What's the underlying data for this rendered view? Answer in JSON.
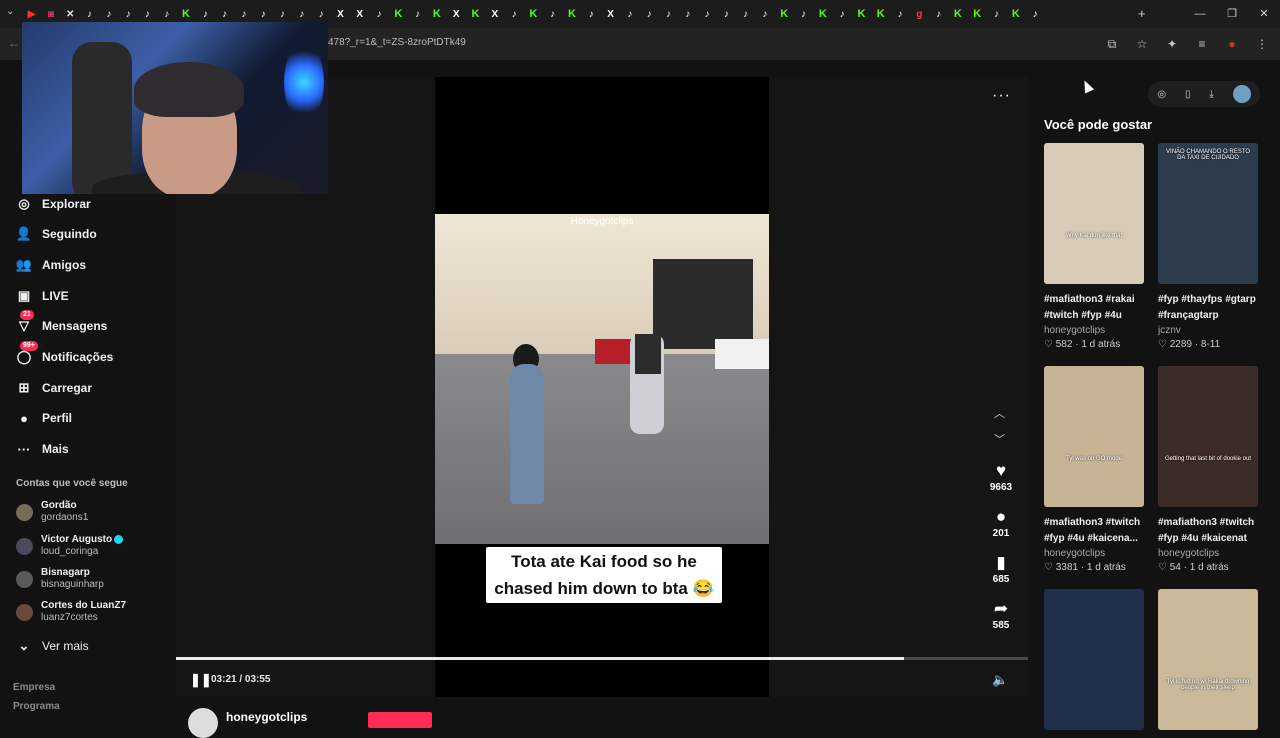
{
  "browser": {
    "url": "478?_r=1&_t=ZS-8zroPtDTk49",
    "tab_icons": [
      "yt",
      "ig",
      "close",
      "tk",
      "tk",
      "tk",
      "tk",
      "tk",
      "kk",
      "tk",
      "tk",
      "tk",
      "tk",
      "tk",
      "tk",
      "tk",
      "xx",
      "xx",
      "tk",
      "kk",
      "tk",
      "kk",
      "xx",
      "kk",
      "xx",
      "tk",
      "kk",
      "tk",
      "kk",
      "tk",
      "xx",
      "tk",
      "tk",
      "tk",
      "tk",
      "tk",
      "tk",
      "tk",
      "tk",
      "kk",
      "tk",
      "kk",
      "tk",
      "kk",
      "kk",
      "tk",
      "gg",
      "tk",
      "kk",
      "kk",
      "tk",
      "kk",
      "tk"
    ],
    "new_tab_symbol": "+",
    "window_controls": [
      "—",
      "❐",
      "✕"
    ]
  },
  "sidebar": {
    "items": [
      {
        "icon": "explore-icon",
        "glyph": "◎",
        "label": "Explorar"
      },
      {
        "icon": "following-icon",
        "glyph": "👤",
        "label": "Seguindo"
      },
      {
        "icon": "friends-icon",
        "glyph": "👥",
        "label": "Amigos"
      },
      {
        "icon": "live-icon",
        "glyph": "▣",
        "label": "LIVE"
      },
      {
        "icon": "messages-icon",
        "glyph": "▽",
        "label": "Mensagens",
        "badge": "21"
      },
      {
        "icon": "notifications-icon",
        "glyph": "◯",
        "label": "Notificações",
        "badge": "99+"
      },
      {
        "icon": "upload-icon",
        "glyph": "⊞",
        "label": "Carregar"
      },
      {
        "icon": "profile-icon",
        "glyph": "●",
        "label": "Perfil"
      },
      {
        "icon": "more-icon",
        "glyph": "···",
        "label": "Mais"
      }
    ],
    "following_header": "Contas que você segue",
    "accounts": [
      {
        "name": "Gordão",
        "handle": "gordaons1",
        "verified": false
      },
      {
        "name": "Victor Augusto",
        "handle": "loud_coringa",
        "verified": true
      },
      {
        "name": "Bisnagarp",
        "handle": "bisnaguinharp",
        "verified": false
      },
      {
        "name": "Cortes do LuanZ7",
        "handle": "luanz7cortes",
        "verified": false
      }
    ],
    "see_more": "Ver mais",
    "footer": [
      "Empresa",
      "Programa"
    ]
  },
  "player": {
    "watermark": "Honeygotclips",
    "caption_line1": "Tota ate Kai food so he",
    "caption_line2": "chased him down to bta 😂",
    "likes": "9663",
    "comments": "201",
    "saves": "685",
    "shares": "585",
    "time": "03:21 / 03:55",
    "progress": 0.8545,
    "author": "honeygotclips"
  },
  "recommendations": {
    "title": "Você pode gostar",
    "cards": [
      {
        "title": "#mafiathon3 #rakai #twitch #fyp #4u",
        "user": "honeygotclips",
        "likes": "582",
        "when": "1 d atrás",
        "thumb_color": "#d7cbb8",
        "thumb_text": "Why Kai dun like that"
      },
      {
        "title": "#fyp #thayfps #gtarp #françagtarp",
        "user": "jcznv",
        "likes": "2289",
        "when": "8-11",
        "thumb_color": "#2d3c4d",
        "thumb_text": "VINÃO CHAMANDO O RESTO DA TAXI DE CUIDADO"
      },
      {
        "title": "#mafiathon3 #twitch #fyp #4u #kaicena...",
        "user": "honeygotclips",
        "likes": "3381",
        "when": "1 d atrás",
        "thumb_color": "#c7b497",
        "thumb_text": "Tyl was on GO mode"
      },
      {
        "title": "#mafiathon3 #twitch #fyp #4u #kaicenat",
        "user": "honeygotclips",
        "likes": "54",
        "when": "1 d atrás",
        "thumb_color": "#3b2c27",
        "thumb_text": "Getting that last bit of dookie out"
      },
      {
        "title": "",
        "user": "",
        "likes": "",
        "when": "",
        "thumb_color": "#1f2f4a",
        "thumb_text": ""
      },
      {
        "title": "",
        "user": "",
        "likes": "",
        "when": "",
        "thumb_color": "#c9b89a",
        "thumb_text": "Tyl is fed up w/ Rakai drowning people in their sleep"
      }
    ]
  }
}
